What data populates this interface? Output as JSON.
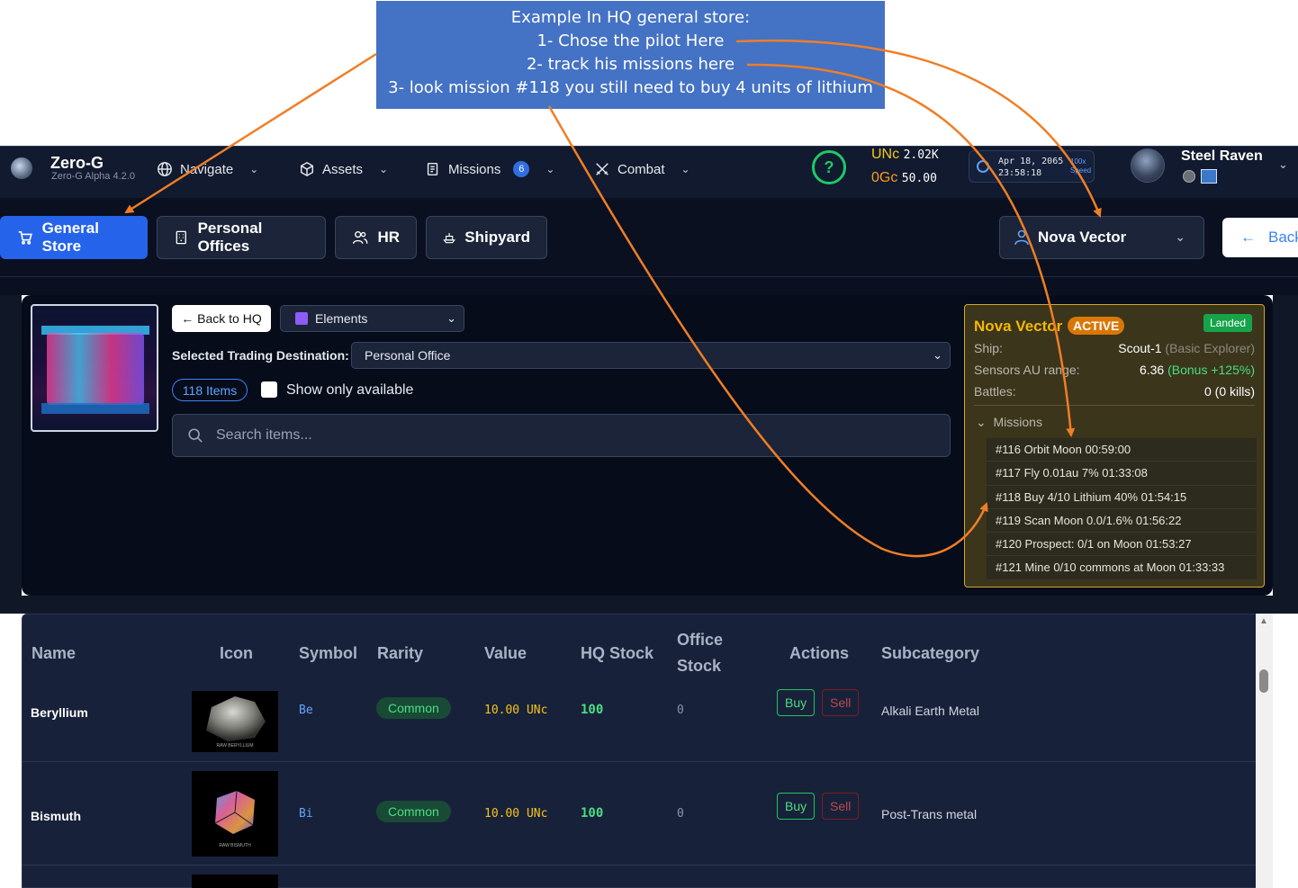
{
  "callout": {
    "line1": "Example In HQ general store:",
    "line2": "1- Chose the pilot Here",
    "line3": "2- track his missions here",
    "line4": "3- look mission #118 you still need to buy 4 units of lithium"
  },
  "app": {
    "title": "Zero-G",
    "version": "Zero-G Alpha 4.2.0"
  },
  "nav": {
    "navigate": "Navigate",
    "assets": "Assets",
    "missions": "Missions",
    "missions_count": "6",
    "combat": "Combat"
  },
  "currency": {
    "unc_label": "UNc",
    "unc_value": "2.02K",
    "ogc_label": "0Gc",
    "ogc_value": "50.00"
  },
  "clock": {
    "date": "Apr 18, 2065",
    "time": "23:58:18",
    "speed": "100x",
    "speed_label": "Speed"
  },
  "user": {
    "name": "Steel Raven"
  },
  "tabs": {
    "general_store": "General Store",
    "personal_offices": "Personal Offices",
    "hr": "HR",
    "shipyard": "Shipyard"
  },
  "pilot_select": {
    "value": "Nova Vector"
  },
  "back_label": "Back",
  "store": {
    "back_hq": "← Back to HQ",
    "category": "Elements",
    "dest_label": "Selected Trading Destination:",
    "dest_value": "Personal Office",
    "items_count": "118 Items",
    "show_available": "Show only available",
    "search_placeholder": "Search items..."
  },
  "pilot_card": {
    "name": "Nova Vector",
    "status": "ACTIVE",
    "location": "Landed",
    "ship_label": "Ship:",
    "ship_value": "Scout-1",
    "ship_type": "(Basic Explorer)",
    "sensors_label": "Sensors AU range:",
    "sensors_value": "6.36",
    "sensors_bonus": "(Bonus +125%)",
    "battles_label": "Battles:",
    "battles_value": "0 (0 kills)",
    "missions_header": "Missions",
    "missions": [
      "#116 Orbit Moon 00:59:00",
      "#117 Fly 0.01au 7% 01:33:08",
      "#118 Buy 4/10 Lithium 40% 01:54:15",
      "#119 Scan Moon 0.0/1.6% 01:56:22",
      "#120 Prospect: 0/1 on Moon 01:53:27",
      "#121 Mine 0/10 commons at Moon 01:33:33"
    ]
  },
  "table": {
    "headers": {
      "name": "Name",
      "icon": "Icon",
      "symbol": "Symbol",
      "rarity": "Rarity",
      "value": "Value",
      "hq_stock": "HQ Stock",
      "office_stock_1": "Office",
      "office_stock_2": "Stock",
      "actions": "Actions",
      "subcategory": "Subcategory"
    },
    "rows": [
      {
        "name": "Beryllium",
        "icon_caption": "RAW BERYLLIUM",
        "symbol": "Be",
        "rarity": "Common",
        "value": "10.00 UNc",
        "hq_stock": "100",
        "office_stock": "0",
        "buy": "Buy",
        "sell": "Sell",
        "subcategory": "Alkali Earth Metal"
      },
      {
        "name": "Bismuth",
        "icon_caption": "RAW BISMUTH",
        "symbol": "Bi",
        "rarity": "Common",
        "value": "10.00 UNc",
        "hq_stock": "100",
        "office_stock": "0",
        "buy": "Buy",
        "sell": "Sell",
        "subcategory": "Post-Trans metal"
      }
    ]
  },
  "colors": {
    "callout_bg": "#4472c4",
    "arrow": "#f07e26",
    "accent_blue": "#2563eb",
    "pilot_gold": "#f5b800",
    "nav_bg": "#111a2e"
  }
}
